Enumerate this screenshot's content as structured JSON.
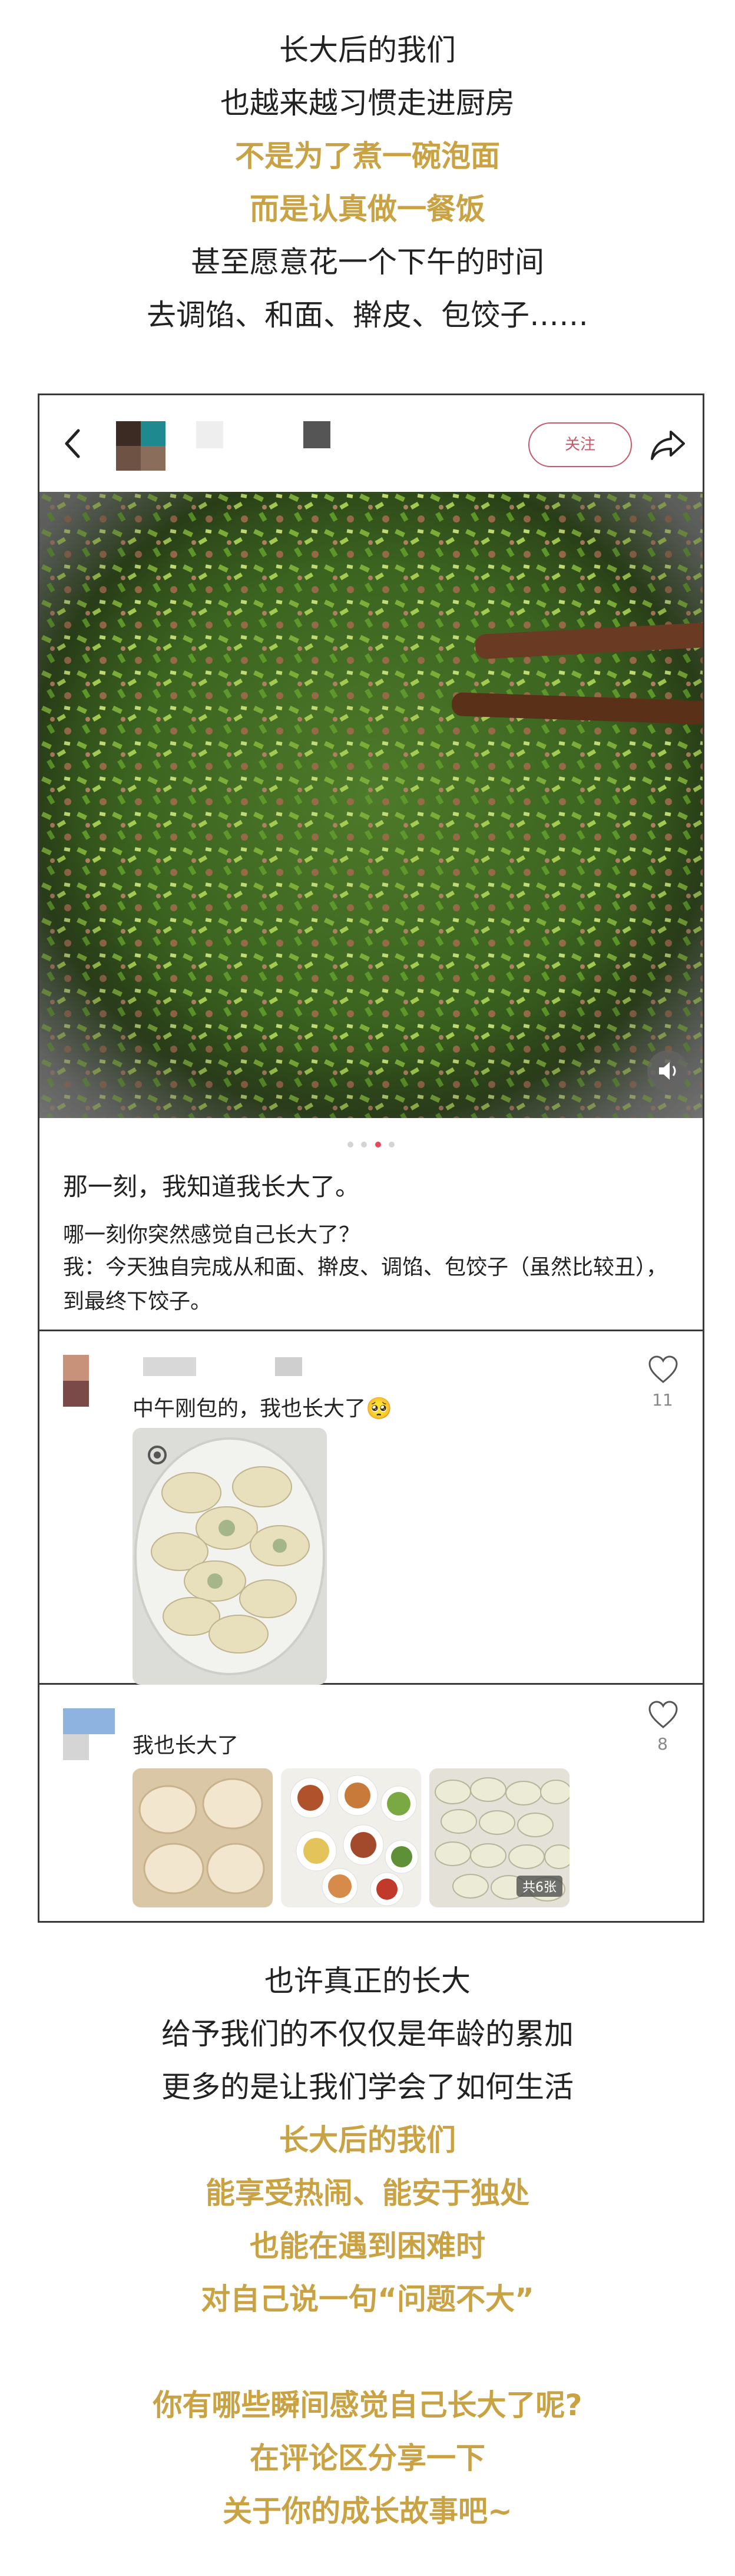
{
  "intro_lines": [
    {
      "text": "长大后的我们",
      "style": "dark"
    },
    {
      "text": "也越来越习惯走进厨房",
      "style": "dark"
    },
    {
      "text": "不是为了煮一碗泡面",
      "style": "gold"
    },
    {
      "text": "而是认真做一餐饭",
      "style": "gold"
    },
    {
      "text": "甚至愿意花一个下午的时间",
      "style": "dark"
    },
    {
      "text": "去调馅、和面、擀皮、包饺子……",
      "style": "dark"
    }
  ],
  "post": {
    "follow_label": "关注",
    "title": "那一刻，我知道我长大了。",
    "question": "哪一刻你突然感觉自己长大了？",
    "body": "我：今天独自完成从和面、擀皮、调馅、包饺子（虽然比较丑），到最终下饺子。",
    "carousel_index": 3,
    "carousel_total": 4
  },
  "comments": [
    {
      "text": "中午刚包的，我也长大了🥺",
      "likes": "11"
    },
    {
      "text": "我也长大了",
      "likes": "8",
      "image_count_badge": "共6张"
    }
  ],
  "outro_lines": [
    {
      "text": "也许真正的长大",
      "style": "dark"
    },
    {
      "text": "给予我们的不仅仅是年龄的累加",
      "style": "dark"
    },
    {
      "text": "更多的是让我们学会了如何生活",
      "style": "dark"
    },
    {
      "text": "长大后的我们",
      "style": "gold"
    },
    {
      "text": "能享受热闹、能安于独处",
      "style": "gold"
    },
    {
      "text": "也能在遇到困难时",
      "style": "gold"
    },
    {
      "text": "对自己说一句“问题不大”",
      "style": "gold"
    },
    {
      "text": "",
      "style": "gold"
    },
    {
      "text": "你有哪些瞬间感觉自己长大了呢?",
      "style": "gold"
    },
    {
      "text": "在评论区分享一下",
      "style": "gold"
    },
    {
      "text": "关于你的成长故事吧~",
      "style": "gold"
    }
  ],
  "colors": {
    "accent_gold": "#c9a243",
    "follow_red": "#c55a6a",
    "active_dot": "#e24a5d"
  },
  "icons": [
    "back-icon",
    "share-icon",
    "sound-icon",
    "heart-icon"
  ]
}
